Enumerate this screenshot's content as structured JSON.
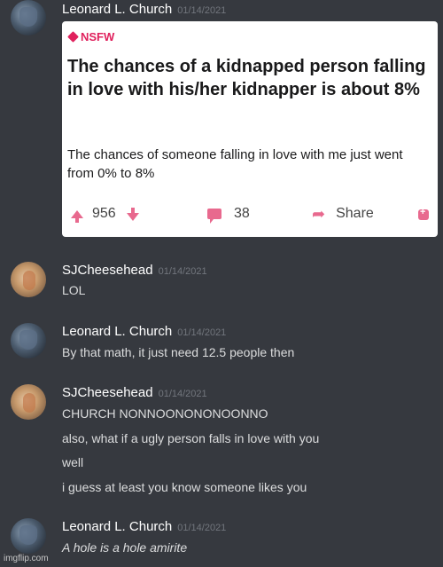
{
  "messages": [
    {
      "username": "Leonard L. Church",
      "timestamp": "01/14/2021",
      "embed": {
        "nsfw_label": "NSFW",
        "title": "The chances of a kidnapped person falling in love with his/her kidnapper is about 8%",
        "body": "The chances of someone falling in love with me just went from 0% to 8%",
        "votes": "956",
        "comments": "38",
        "share_label": "Share"
      }
    },
    {
      "username": "SJCheesehead",
      "timestamp": "01/14/2021",
      "lines": [
        "LOL"
      ]
    },
    {
      "username": "Leonard L. Church",
      "timestamp": "01/14/2021",
      "lines": [
        "By that math, it just need 12.5 people then"
      ]
    },
    {
      "username": "SJCheesehead",
      "timestamp": "01/14/2021",
      "lines": [
        "CHURCH NONNOONONONOONNO",
        "also, what if a ugly person falls in love with you",
        "well",
        "i guess at least you know someone likes you"
      ]
    },
    {
      "username": "Leonard L. Church",
      "timestamp": "01/14/2021",
      "lines": [
        "A hole is a hole amirite"
      ]
    }
  ],
  "watermark": "imgflip.com"
}
